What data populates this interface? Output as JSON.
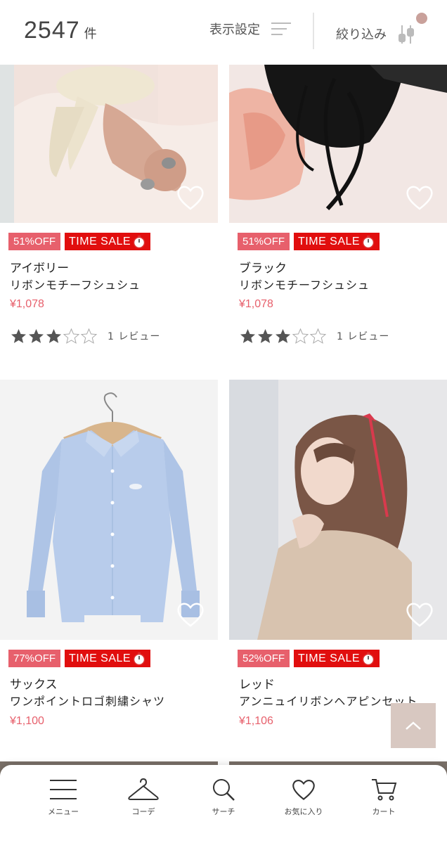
{
  "header": {
    "count": "2547",
    "count_unit": "件",
    "display_settings_label": "表示設定",
    "filter_label": "絞り込み"
  },
  "products": [
    {
      "discount": "51%OFF",
      "sale_label": "TIME SALE",
      "color": "アイボリー",
      "name": "リボンモチーフシュシュ",
      "price": "¥1,078",
      "rating": 3,
      "review_text": "1 レビュー"
    },
    {
      "discount": "51%OFF",
      "sale_label": "TIME SALE",
      "color": "ブラック",
      "name": "リボンモチーフシュシュ",
      "price": "¥1,078",
      "rating": 3,
      "review_text": "1 レビュー"
    },
    {
      "discount": "77%OFF",
      "sale_label": "TIME SALE",
      "color": "サックス",
      "name": "ワンポイントロゴ刺繍シャツ",
      "price": "¥1,100"
    },
    {
      "discount": "52%OFF",
      "sale_label": "TIME SALE",
      "color": "レッド",
      "name": "アンニュイリボンヘアピンセット",
      "price": "¥1,106"
    }
  ],
  "bottom_nav": {
    "items": [
      {
        "label": "メニュー",
        "icon": "menu-icon"
      },
      {
        "label": "コーデ",
        "icon": "hanger-icon"
      },
      {
        "label": "サーチ",
        "icon": "search-icon"
      },
      {
        "label": "お気に入り",
        "icon": "heart-icon"
      },
      {
        "label": "カート",
        "icon": "cart-icon"
      }
    ]
  },
  "colors": {
    "discount_badge": "#e7606c",
    "sale_badge": "#e10e0e",
    "price": "#e7606c",
    "scroll_top": "#d8c8c1",
    "filter_dot": "#c9a19b"
  }
}
